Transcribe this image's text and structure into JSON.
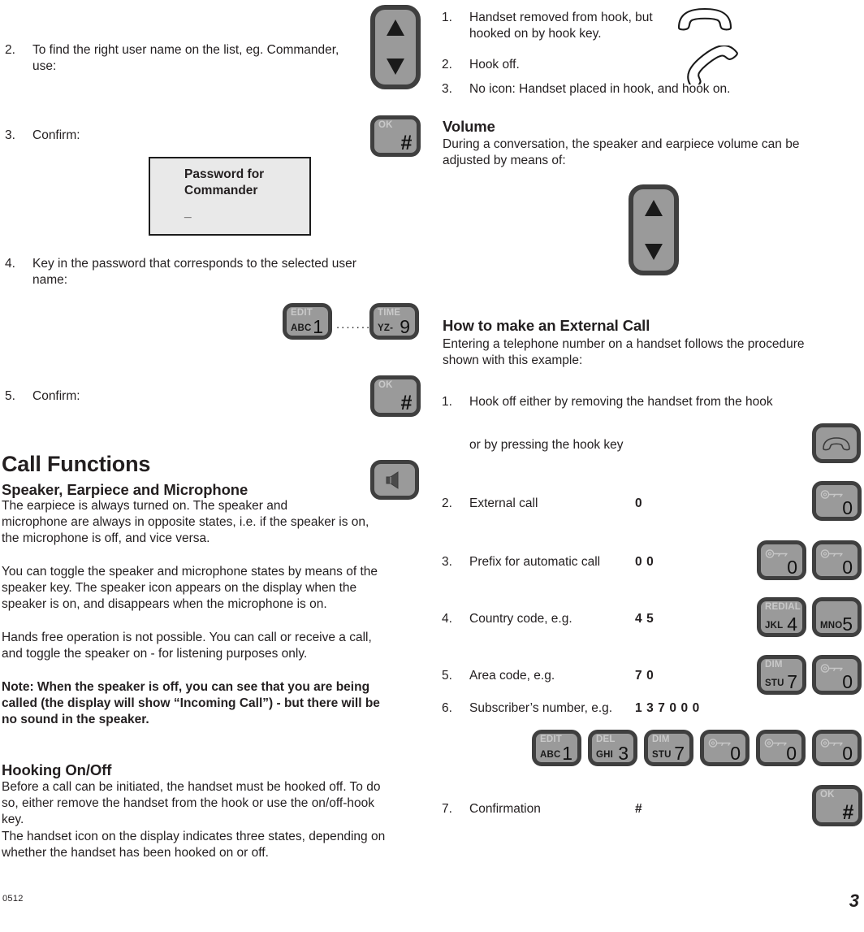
{
  "page": {
    "footer_code": "0512",
    "page_number": "3"
  },
  "left_column": {
    "step2": {
      "num": "2.",
      "text": "To find the right user name on the list, eg. Commander,\nuse:"
    },
    "step3": {
      "num": "3.",
      "text": "Confirm:"
    },
    "display": {
      "line1": "Password for",
      "line2": "Commander",
      "line3": "_"
    },
    "step4": {
      "num": "4.",
      "text": "Key in the password that corresponds to the selected user\nname:"
    },
    "step5": {
      "num": "5.",
      "text": "Confirm:"
    },
    "heading_call_functions": "Call Functions",
    "heading_speaker": "Speaker, Earpiece and Microphone",
    "para_speaker_1": "The earpiece is always turned on. The speaker and\nmicrophone are always in opposite states, i.e. if the speaker is on,\nthe microphone is off, and vice versa.",
    "para_speaker_2": "You can toggle the speaker and microphone states by means of the\nspeaker key. The speaker icon appears on the display when the\nspeaker is on, and disappears when the microphone is on.",
    "para_speaker_3": "Hands free operation is not possible. You can call or receive a call,\nand toggle the speaker on - for listening purposes only.",
    "note": "Note: When the speaker is off, you can see that you are being\ncalled (the display will show “Incoming Call”) - but there will be\nno sound in the speaker.",
    "heading_hooking": "Hooking On/Off",
    "para_hooking_1": "Before a call can be initiated, the handset must be hooked off. To do\nso, either remove the handset from the hook or use the on/off-hook\nkey.",
    "para_hooking_2": "The handset icon on the display indicates three states, depending on\nwhether the handset has been hooked on or off."
  },
  "right_column": {
    "hook_states": [
      {
        "num": "1.",
        "text": "Handset removed from hook,\nbut hooked on by hook key."
      },
      {
        "num": "2.",
        "text": "Hook off."
      },
      {
        "num": "3.",
        "text": "No icon: Handset placed in hook, and hook on."
      }
    ],
    "heading_volume": "Volume",
    "para_volume": "During a conversation, the speaker and earpiece volume can be\nadjusted by means of:",
    "heading_external_call": "How to make an External Call",
    "para_external_call": "Entering a telephone number on a handset follows the procedure\nshown with this example:",
    "steps": [
      {
        "num": "1.",
        "text": "Hook off either by removing the handset from the hook",
        "value": ""
      },
      {
        "num": "",
        "text": "or by pressing the hook key",
        "value": ""
      },
      {
        "num": "2.",
        "text": "External call",
        "value": "0"
      },
      {
        "num": "3.",
        "text": "Prefix for automatic call",
        "value": "0 0"
      },
      {
        "num": "4.",
        "text": "Country code, e.g.",
        "value": "4 5"
      },
      {
        "num": "5.",
        "text": "Area code, e.g.",
        "value": "7 0"
      },
      {
        "num": "6.",
        "text": "Subscriber’s number, e.g.",
        "value": "1 3 7 0 0 0"
      },
      {
        "num": "7.",
        "text": "Confirmation",
        "value": "#"
      }
    ]
  },
  "keys": {
    "nav_rocker_left": {
      "icon": "up-down-arrows"
    },
    "ok_hash_top": {
      "top": "OK",
      "digit": "#"
    },
    "key_1_edit": {
      "top": "EDIT",
      "letters": "ABC",
      "digit": "1"
    },
    "key_9_time": {
      "top": "TIME",
      "letters": "YZ-",
      "digit": "9"
    },
    "dots_connector": "........",
    "ok_hash_step5": {
      "top": "OK",
      "digit": "#"
    },
    "speaker_key": {
      "icon": "speaker-icon"
    },
    "volume_rocker": {
      "icon": "up-down-arrows"
    },
    "hook_key": {
      "icon": "handset-hook-icon"
    },
    "key_0_a": {
      "top": "",
      "letters": "",
      "digit": "0",
      "icon": "key-icon"
    },
    "key_0_b": {
      "top": "",
      "letters": "",
      "digit": "0",
      "icon": "key-icon"
    },
    "key_0_c": {
      "top": "",
      "letters": "",
      "digit": "0",
      "icon": "key-icon"
    },
    "key_4_redial": {
      "top": "REDIAL",
      "letters": "JKL",
      "digit": "4"
    },
    "key_5_mno": {
      "top": "",
      "letters": "MNO",
      "digit": "5"
    },
    "key_7_dim": {
      "top": "DIM",
      "letters": "STU",
      "digit": "7"
    },
    "key_0_d": {
      "top": "",
      "letters": "",
      "digit": "0",
      "icon": "key-icon"
    },
    "row6": {
      "k1": {
        "top": "EDIT",
        "letters": "ABC",
        "digit": "1"
      },
      "k3": {
        "top": "DEL",
        "letters": "GHI",
        "digit": "3"
      },
      "k7": {
        "top": "DIM",
        "letters": "STU",
        "digit": "7"
      },
      "k0a": {
        "digit": "0",
        "icon": "key-icon"
      },
      "k0b": {
        "digit": "0",
        "icon": "key-icon"
      },
      "k0c": {
        "digit": "0",
        "icon": "key-icon"
      }
    },
    "ok_hash_step7": {
      "top": "OK",
      "digit": "#"
    }
  },
  "colors": {
    "key_face": "#9a9a9a",
    "key_border": "#3f3f3f",
    "lcd_bg": "#e9e9e9",
    "text": "#231f20"
  }
}
